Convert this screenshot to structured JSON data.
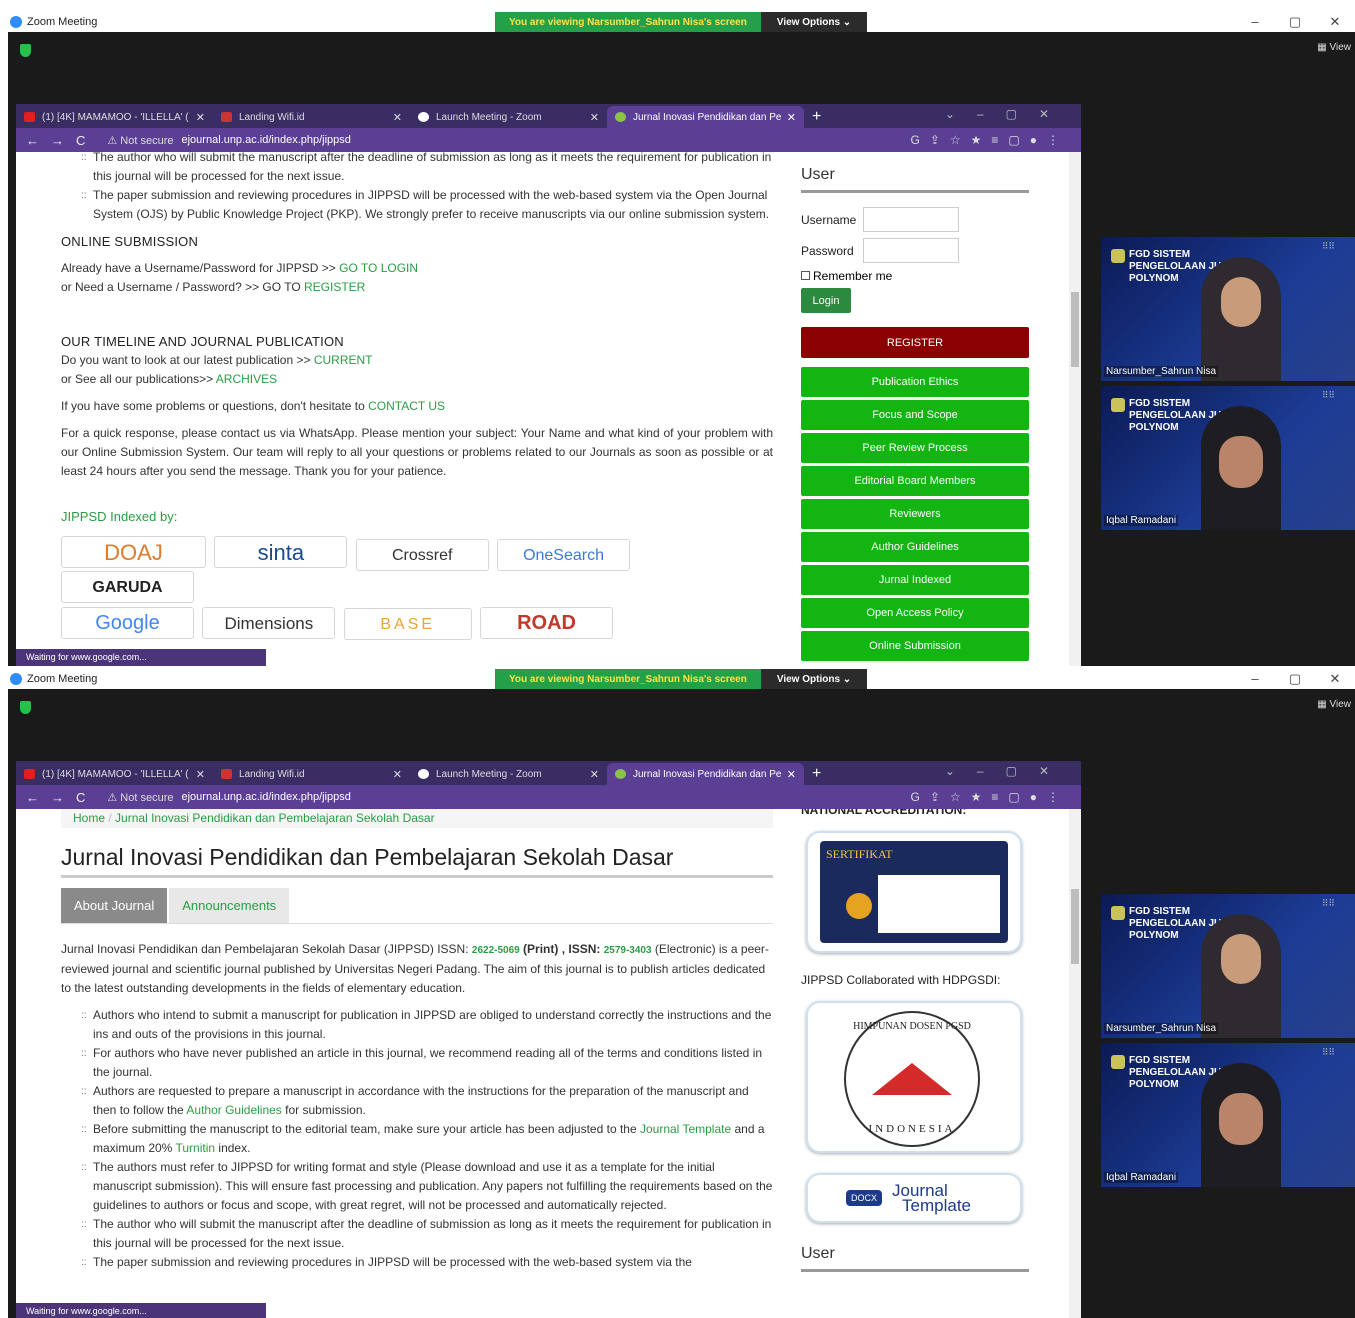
{
  "zoom": {
    "title": "Zoom Meeting",
    "banner": "You are viewing Narsumber_Sahrun Nisa's screen",
    "view_options": "View Options ⌄",
    "view": "View",
    "min": "–",
    "restore": "▢",
    "close": "✕"
  },
  "tabs": [
    {
      "label": "(1) [4K] MAMAMOO - 'ILLELLA' (",
      "color": "#e02020"
    },
    {
      "label": "Landing Wifi.id",
      "color": "#cc3333"
    },
    {
      "label": "Launch Meeting - Zoom",
      "color": "#ffffff"
    },
    {
      "label": "Jurnal Inovasi Pendidikan dan Pe",
      "color": "#8bc34a"
    }
  ],
  "address": {
    "not_secure": "⚠ Not secure",
    "url": "ejournal.unp.ac.id/index.php/jippsd"
  },
  "status": "Waiting for www.google.com...",
  "top": {
    "bullets": [
      "The author who will submit the manuscript after the deadline of submission as long as it meets the requirement for publication in this journal will be processed for the next issue.",
      "The paper submission and reviewing procedures in JIPPSD will be processed with the web-based system via the Open Journal System (OJS) by Public Knowledge Project (PKP). We strongly prefer to receive manuscripts via our online submission system."
    ],
    "online_sub": "ONLINE SUBMISSION",
    "already": "Already have a Username/Password for JIPPSD >> ",
    "go_login": "GO TO LOGIN",
    "need": "or Need a Username / Password? >> GO TO ",
    "register_link": "REGISTER",
    "timeline": "OUR TIMELINE AND JOURNAL PUBLICATION",
    "latest": "Do you want to look at our latest publication >> ",
    "current": "CURRENT",
    "seeall": "or See all our publications>> ",
    "archives": "ARCHIVES",
    "problems": "If you have some problems or questions, don't hesitate to ",
    "contact": "CONTACT US",
    "quick": "For a quick response, please contact us via WhatsApp. Please mention your subject: Your Name and what kind of your problem with our Online Submission System. Our team will reply to all your questions or problems related to our Journals as soon as possible or at least 24 hours after you send the message. Thank you for your patience.",
    "indexed": "JIPPSD Indexed by:",
    "logos1": [
      "DOAJ",
      "sinta",
      "Crossref",
      "OneSearch",
      "GARUDA"
    ],
    "logos2": [
      "Google",
      "Dimensions",
      "BASE",
      "ROAD"
    ],
    "user": "User",
    "username": "Username",
    "password": "Password",
    "remember": "Remember me",
    "login": "Login",
    "register": "REGISTER",
    "menu": [
      "Publication Ethics",
      "Focus and Scope",
      "Peer Review Process",
      "Editorial Board Members",
      "Reviewers",
      "Author Guidelines",
      "Jurnal Indexed",
      "Open Access Policy",
      "Online Submission"
    ]
  },
  "bottom": {
    "home": "Home",
    "crumb": "Jurnal Inovasi Pendidikan dan Pembelajaran Sekolah Dasar",
    "title": "Jurnal Inovasi Pendidikan dan Pembelajaran Sekolah Dasar",
    "tab1": "About Journal",
    "tab2": "Announcements",
    "intro_a": "Jurnal Inovasi Pendidikan dan Pembelajaran Sekolah Dasar (JIPPSD) ISSN: ",
    "issn1": "2622-5069",
    "intro_b": " (Print) , ISSN: ",
    "issn2": "2579-3403",
    "intro_c": " (Electronic) is a peer-reviewed journal and scientific journal  published by Universitas Negeri Padang.  The aim of this journal is to publish articles dedicated to the latest outstanding developments in the fields of elementary education.",
    "b1": "Authors who intend to submit a manuscript for publication in JIPPSD are obliged to understand correctly the instructions and the ins and outs of the provisions in this journal.",
    "b2": "For authors who have never published an article in this journal, we recommend reading all of the terms and conditions listed in the journal.",
    "b3a": "Authors are requested to prepare a manuscript in accordance with the instructions for the preparation of the manuscript and then to follow the ",
    "b3l": "Author Guidelines",
    "b3b": " for submission.",
    "b4a": "Before submitting the manuscript to the editorial team, make sure your article has been adjusted to the ",
    "b4l": "Journal Template",
    "b4b": " and a maximum 20% ",
    "b4l2": "Turnitin",
    "b4c": " index.",
    "b5": "The authors must refer to JIPPSD for writing format and style (Please download and use it as a template for the initial manuscript submission). This will ensure fast processing and publication. Any papers not fulfilling the requirements based on the guidelines to authors or focus and scope, with great regret, will not be processed and automatically rejected.",
    "b6": "The author who will submit the manuscript after the deadline of submission as long as it meets the requirement for publication in this journal will be processed for the next issue.",
    "b7": "The paper submission and reviewing procedures in JIPPSD will be processed with the web-based system via the",
    "accred": "NATIONAL ACCREDITATION:",
    "sertifikat": "SERTIFIKAT",
    "collab": "JIPPSD Collaborated with HDPGSDI:",
    "hdpgsdi_top": "HIMPUNAN DOSEN PGSD",
    "hdpgsdi_bot": "INDONESIA",
    "docx": "DOCX",
    "journal_tpl1": "Journal",
    "journal_tpl2": "Template",
    "user": "User"
  },
  "videos": [
    {
      "banner": "FGD SISTEM PENGELOLAAN JURNAL POLYNOM",
      "name": "Narsumber_Sahrun Nisa"
    },
    {
      "banner": "FGD SISTEM PENGELOLAAN JURNAL POLYNOM",
      "name": "Iqbal Ramadani"
    }
  ]
}
